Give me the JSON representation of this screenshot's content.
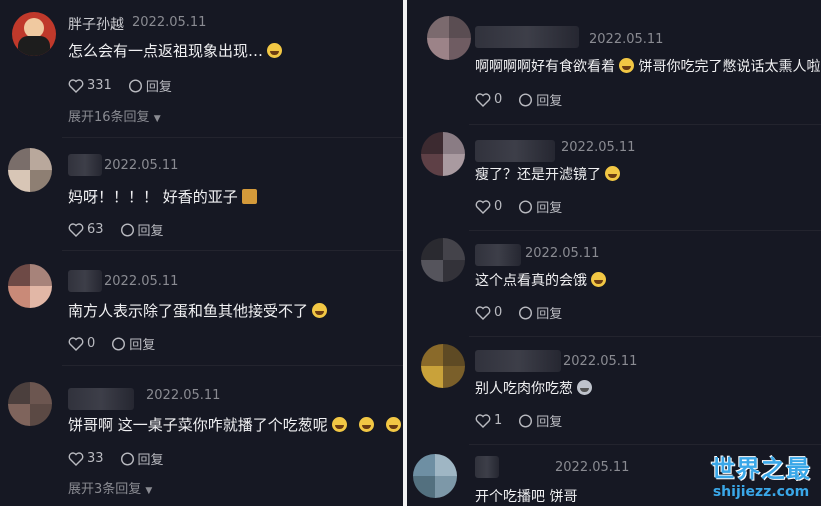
{
  "left": {
    "comments": [
      {
        "name": "胖子孙越",
        "date": "2022.05.11",
        "text": "怎么会有一点返祖现象出现…",
        "emoji": "laughing-emoji",
        "likes": "331",
        "reply": "回复",
        "expand": "展开16条回复"
      },
      {
        "name": "",
        "date": "2022.05.11",
        "text": "妈呀！！！！ 好香的亚子",
        "emoji": "box-emoji",
        "likes": "63",
        "reply": "回复",
        "expand": ""
      },
      {
        "name": "",
        "date": "2022.05.11",
        "text": "南方人表示除了蛋和鱼其他接受不了",
        "emoji": "laughing-emoji",
        "likes": "0",
        "reply": "回复",
        "expand": ""
      },
      {
        "name": "",
        "date": "2022.05.11",
        "text": "饼哥啊 这一桌子菜你咋就播了个吃葱呢",
        "emoji": "laughing-emoji",
        "likes": "33",
        "reply": "回复",
        "expand": "展开3条回复"
      }
    ]
  },
  "right": {
    "comments": [
      {
        "date": "2022.05.11",
        "text": "啊啊啊啊好有食欲看着",
        "text2": "饼哥你吃完了憋说话太熏人啦",
        "likes": "0",
        "reply": "回复"
      },
      {
        "date": "2022.05.11",
        "text": "瘦了？还是开滤镜了",
        "likes": "0",
        "reply": "回复"
      },
      {
        "date": "2022.05.11",
        "text": "这个点看真的会饿",
        "likes": "0",
        "reply": "回复"
      },
      {
        "date": "2022.05.11",
        "text": "别人吃肉你吃葱",
        "likes": "1",
        "reply": "回复"
      },
      {
        "date": "2022.05.11",
        "text": "开个吃播吧 饼哥"
      }
    ]
  },
  "watermark": {
    "title": "世界之最",
    "url": "shijiezz.com"
  },
  "colors": {
    "background": "#161823",
    "accent": "#3aa7e8"
  }
}
